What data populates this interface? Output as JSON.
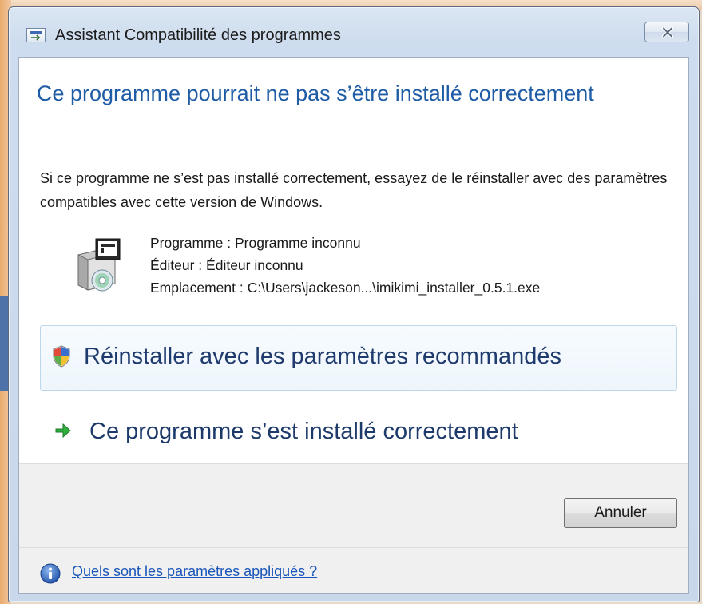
{
  "window": {
    "title": "Assistant Compatibilité des programmes",
    "close_label": "close"
  },
  "dialog": {
    "heading": "Ce programme pourrait ne pas s’être installé correctement",
    "description": "Si ce programme ne s’est pas installé correctement, essayez de le réinstaller avec des paramètres compatibles avec cette version de Windows.",
    "program": {
      "name_line": "Programme : Programme inconnu",
      "publisher_line": "Éditeur : Éditeur inconnu",
      "location_line": "Emplacement : C:\\Users\\jackeson...\\imikimi_installer_0.5.1.exe"
    },
    "options": [
      {
        "label": "Réinstaller avec les paramètres recommandés",
        "icon": "shield-icon"
      },
      {
        "label": "Ce programme s’est installé correctement",
        "icon": "green-arrow-icon"
      }
    ]
  },
  "footer": {
    "cancel_label": "Annuler",
    "help_link": "Quels sont les paramètres appliqués ?"
  },
  "colors": {
    "heading": "#1f5ca6",
    "link": "#1a56b8",
    "selected_bg": "#eef6fc",
    "selected_border": "#bcd6ea",
    "footer_bg": "#f0f0f0"
  }
}
